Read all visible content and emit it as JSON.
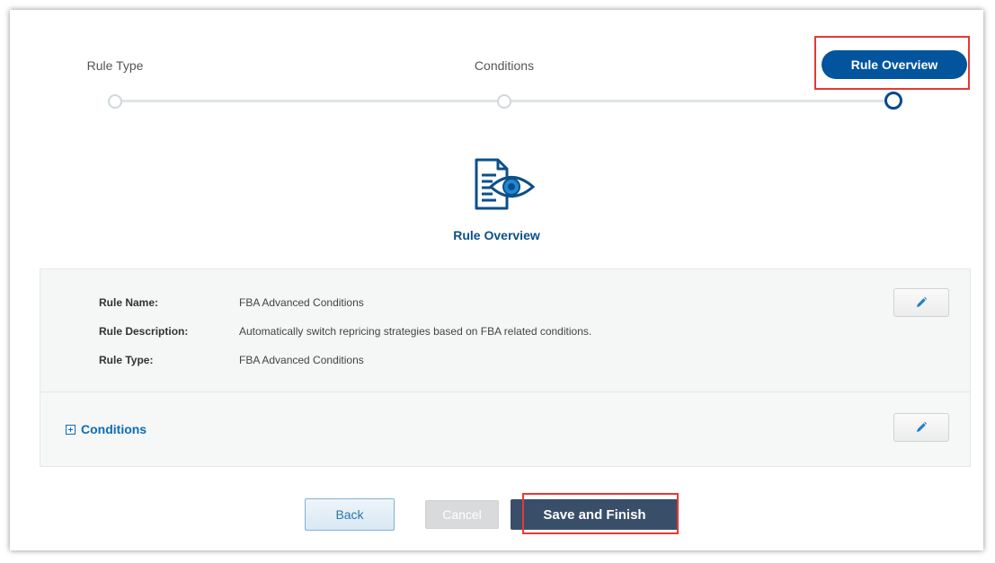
{
  "stepper": {
    "steps": [
      {
        "label": "Rule Type",
        "state": "completed"
      },
      {
        "label": "Conditions",
        "state": "completed"
      },
      {
        "label": "Rule Overview",
        "state": "active"
      }
    ]
  },
  "overview": {
    "icon": "document-eye-icon",
    "title": "Rule Overview"
  },
  "details": {
    "rows": [
      {
        "label": "Rule Name:",
        "value": "FBA Advanced Conditions"
      },
      {
        "label": "Rule Description:",
        "value": "Automatically switch repricing strategies based on FBA related conditions."
      },
      {
        "label": "Rule Type:",
        "value": "FBA Advanced Conditions"
      }
    ],
    "edit_icon": "pencil-icon"
  },
  "conditions": {
    "label": "Conditions",
    "toggle_icon": "plus-square-icon",
    "edit_icon": "pencil-icon"
  },
  "buttons": {
    "back": "Back",
    "cancel": "Cancel",
    "save": "Save and Finish"
  },
  "colors": {
    "primary": "#02559c",
    "dark_button": "#394f69",
    "highlight": "#e53935"
  }
}
